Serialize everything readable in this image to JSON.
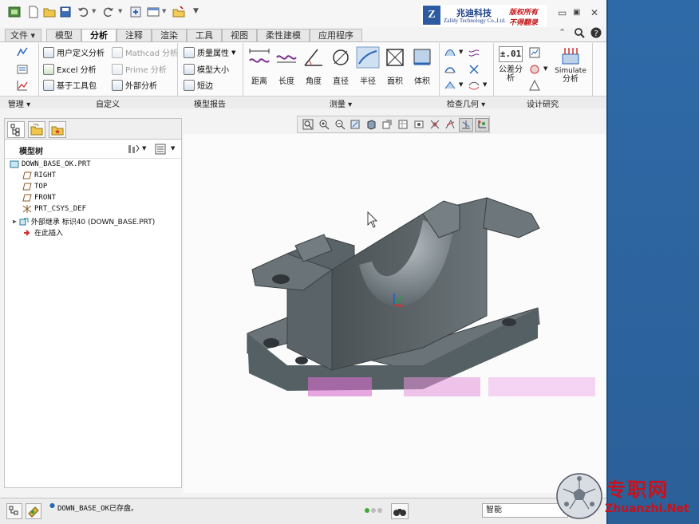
{
  "brand": {
    "logo_letter": "Z",
    "name_cn": "兆迪科技",
    "name_en": "Zalldy Technology Co.,Ltd.",
    "slogan_1": "版权所有",
    "slogan_2": "不得翻录"
  },
  "tabs": [
    "文件",
    "模型",
    "分析",
    "注释",
    "渲染",
    "工具",
    "视图",
    "柔性建模",
    "应用程序"
  ],
  "active_tab": "分析",
  "ribbon": {
    "custom": {
      "user_defined": "用户定义分析",
      "mathcad": "Mathcad 分析",
      "excel": "Excel 分析",
      "prime": "Prime 分析",
      "toolkit": "基于工具包",
      "external": "外部分析"
    },
    "model_report": {
      "mass": "质量属性",
      "model_size": "模型大小",
      "short_edge": "短边"
    },
    "measure": [
      "距离",
      "长度",
      "角度",
      "直径",
      "半径",
      "面积",
      "体积"
    ],
    "design_study": {
      "tolerance_label": "±.01",
      "tolerance": "公差分析",
      "simulate_1": "Simulate",
      "simulate_2": "分析"
    }
  },
  "group_labels": {
    "manage": "管理",
    "custom": "自定义",
    "model_report": "模型报告",
    "measure": "测量",
    "inspect": "检查几何",
    "design_study": "设计研究"
  },
  "model_tree": {
    "title": "模型树",
    "items": [
      "DOWN_BASE_OK.PRT",
      "RIGHT",
      "TOP",
      "FRONT",
      "PRT_CSYS_DEF",
      "外部继承 标识40 (DOWN_BASE.PRT)",
      "在此插入"
    ]
  },
  "status": {
    "message": "DOWN_BASE_OK已存盘。",
    "filter": "智能"
  },
  "watermark": {
    "cn": "专职网",
    "en": "Zhuanzhi.Net"
  },
  "colors": {
    "model": "#5d666b",
    "accent_red": "#c8121b",
    "brand_blue": "#1a3e8a"
  }
}
